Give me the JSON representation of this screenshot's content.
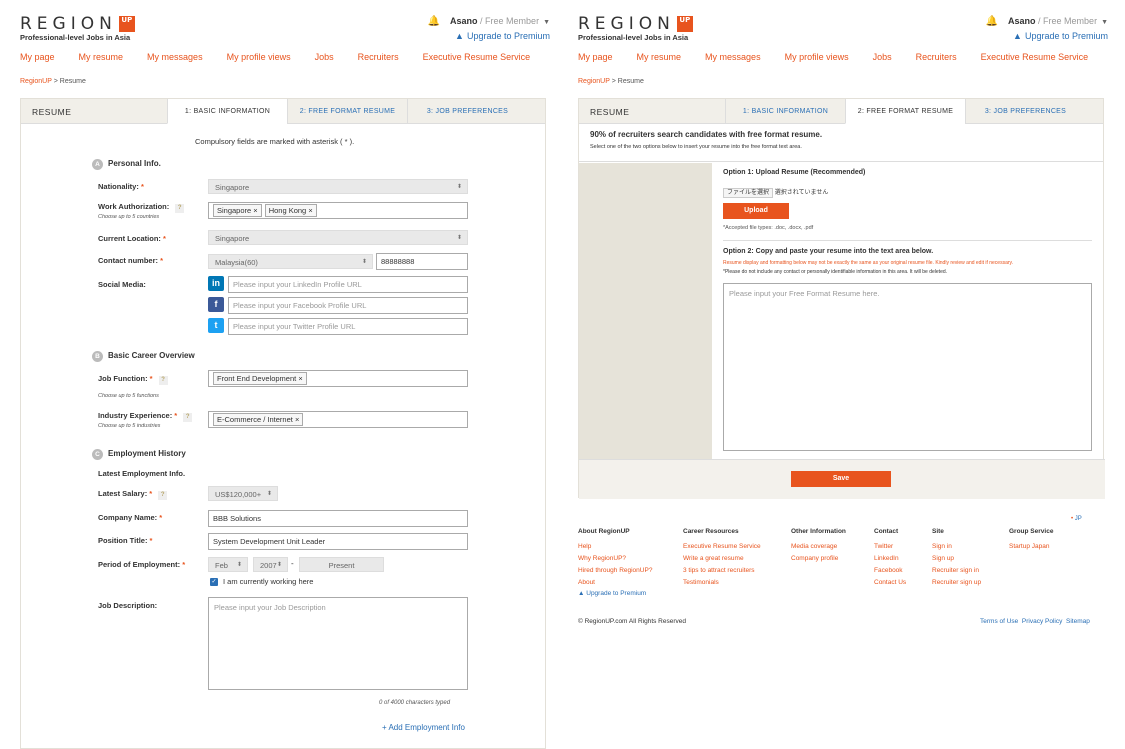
{
  "brand": {
    "word": "REGION",
    "up": "UP",
    "tagline": "Professional-level Jobs in Asia"
  },
  "user": {
    "name": "Asano",
    "sep": "/",
    "tier": "Free Member",
    "upgrade": "Upgrade to Premium"
  },
  "nav": [
    "My page",
    "My resume",
    "My messages",
    "My profile views",
    "Jobs",
    "Recruiters",
    "Executive Resume Service"
  ],
  "breadcrumb": {
    "home": "RegionUP",
    "sep": ">",
    "current": "Resume"
  },
  "resume_title": "RESUME",
  "tabs": [
    "1: BASIC INFORMATION",
    "2: FREE FORMAT RESUME",
    "3: JOB PREFERENCES"
  ],
  "left": {
    "compulsory": "Compulsory fields are marked with asterisk ( * ).",
    "personal": {
      "letter": "A",
      "title": "Personal Info."
    },
    "nationality": {
      "label": "Nationality:",
      "value": "Singapore"
    },
    "work_auth": {
      "label": "Work Authorization:",
      "note": "Choose up to 5 countries",
      "tags": [
        "Singapore",
        "Hong Kong"
      ]
    },
    "location": {
      "label": "Current Location:",
      "value": "Singapore"
    },
    "contact": {
      "label": "Contact number:",
      "country": "Malaysia(60)",
      "number": "88888888"
    },
    "social": {
      "label": "Social Media:",
      "linkedin": "Please input your LinkedIn Profile URL",
      "facebook": "Please input your Facebook Profile URL",
      "twitter": "Please input your Twitter Profile URL"
    },
    "career": {
      "letter": "B",
      "title": "Basic Career Overview"
    },
    "job_function": {
      "label": "Job Function:",
      "note": "Choose up to 5 functions",
      "tag": "Front End Development"
    },
    "industry": {
      "label": "Industry Experience:",
      "note": "Choose up to 5 industries",
      "tag": "E-Commerce / Internet"
    },
    "employment": {
      "letter": "C",
      "title": "Employment History",
      "latest": "Latest Employment Info."
    },
    "salary": {
      "label": "Latest Salary:",
      "value": "US$120,000+"
    },
    "company": {
      "label": "Company Name:",
      "value": "BBB Solutions"
    },
    "position": {
      "label": "Position Title:",
      "value": "System Development Unit Leader"
    },
    "period": {
      "label": "Period of Employment:",
      "month": "Feb",
      "year": "2007",
      "dash": "-",
      "end": "Present",
      "current": "I am currently working here"
    },
    "description": {
      "label": "Job Description:",
      "placeholder": "Please input your Job Description",
      "count": "0 of 4000 characters typed"
    },
    "add": "+ Add Employment Info"
  },
  "right": {
    "headline": "90% of recruiters search candidates with free format resume.",
    "subline": "Select one of the two options below to insert your resume into the free format text area.",
    "opt1": {
      "title": "Option 1: Upload Resume (Recommended)",
      "choose": "ファイルを選択",
      "nofile": "選択されていません",
      "button": "Upload",
      "accepted": "*Accepted file types: .doc, .docx, .pdf"
    },
    "opt2": {
      "title": "Option 2: Copy and paste your resume into the text area below.",
      "warn1": "Resume display and formatting below may not be exactly the same as your original resume file. Kindly review and edit if necessary.",
      "warn2": "*Please do not include any contact or personally identifiable information in this area. It will be deleted.",
      "placeholder": "Please input your Free Format Resume here."
    },
    "save": "Save",
    "lang": "JP",
    "footer": [
      {
        "head": "About RegionUP",
        "links": [
          "Help",
          "Why RegionUP?",
          "Hired through RegionUP?",
          "About"
        ]
      },
      {
        "head": "Career Resources",
        "links": [
          "Executive Resume Service",
          "Write a great resume",
          "3 tips to attract recruiters",
          "Testimonials"
        ]
      },
      {
        "head": "Other Information",
        "links": [
          "Media coverage",
          "Company profile"
        ]
      },
      {
        "head": "Contact",
        "links": [
          "Twitter",
          "LinkedIn",
          "Facebook",
          "Contact Us"
        ]
      },
      {
        "head": "Site",
        "links": [
          "Sign in",
          "Sign up",
          "Recruiter sign in",
          "Recruiter sign up"
        ]
      },
      {
        "head": "Group Service",
        "links": [
          "Startup Japan"
        ]
      }
    ],
    "upgrade": "Upgrade to Premium",
    "copyright": "© RegionUP.com All Rights Reserved",
    "legal": [
      "Terms of Use",
      "Privacy Policy",
      "Sitemap"
    ]
  },
  "colors": {
    "accent": "#e8541e",
    "link": "#2a6fb5",
    "linkedin": "#0077b5",
    "facebook": "#3b5998",
    "twitter": "#1da1f2"
  }
}
